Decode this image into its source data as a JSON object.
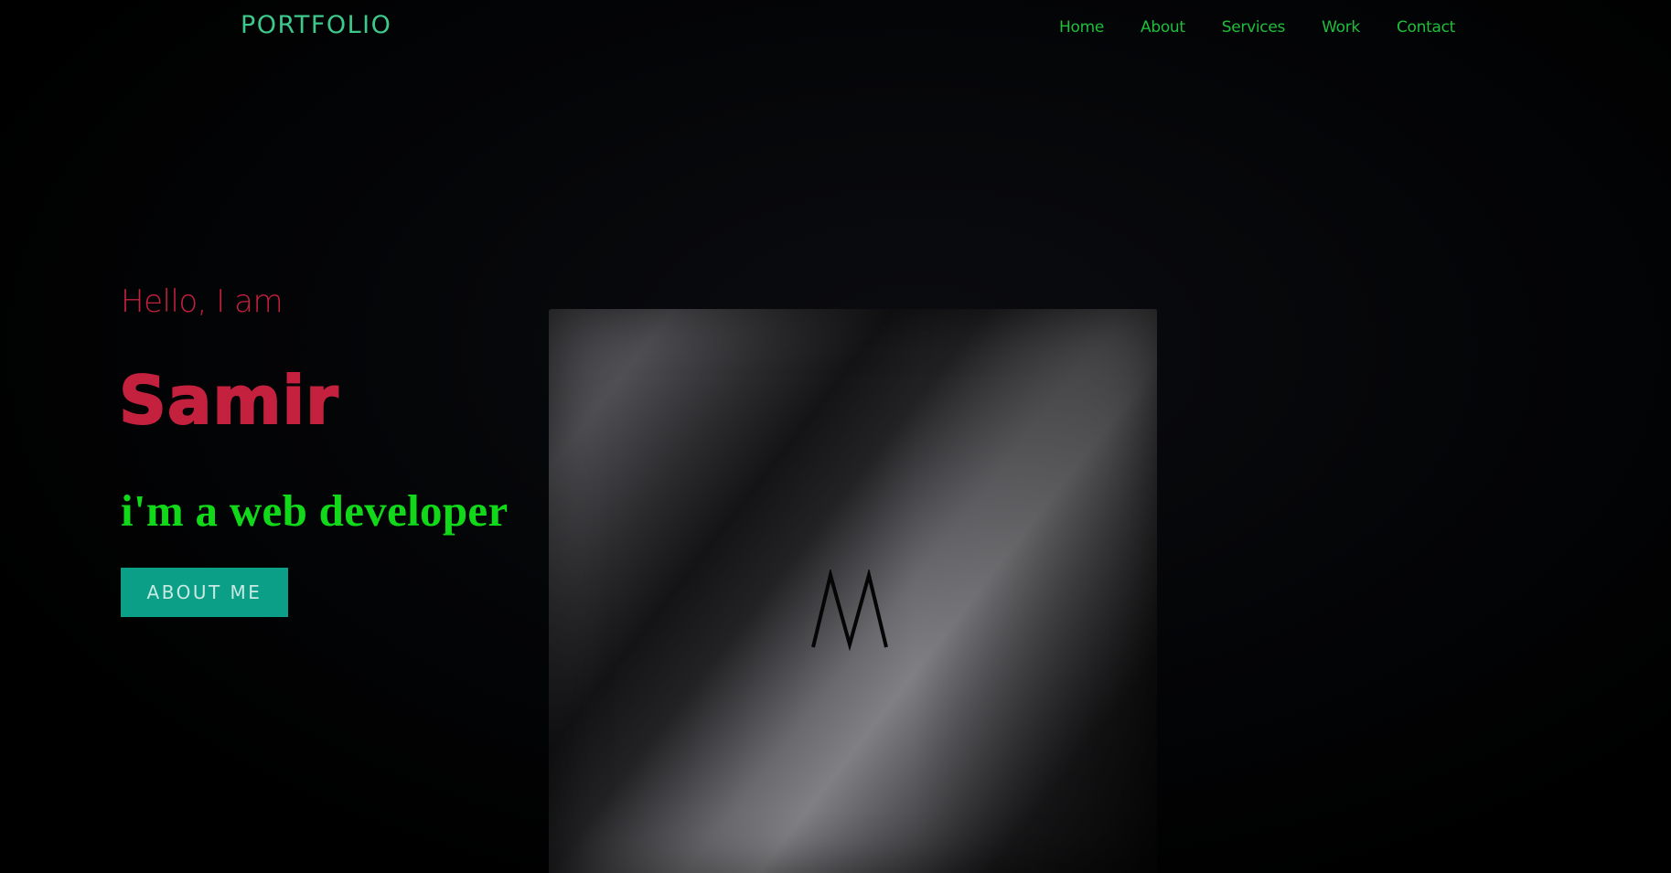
{
  "header": {
    "logo": "PORTFOLIO",
    "nav": [
      {
        "label": "Home"
      },
      {
        "label": "About"
      },
      {
        "label": "Services"
      },
      {
        "label": "Work"
      },
      {
        "label": "Contact"
      }
    ]
  },
  "hero": {
    "greeting": "Hello, I am",
    "name": "Samir",
    "role": "i'm a web developer",
    "button_label": "ABOUT ME",
    "image_letter": "M"
  },
  "colors": {
    "background": "#000000",
    "logo": "#3ec98c",
    "nav": "#1fbf3c",
    "accent_red": "#c4213f",
    "accent_green": "#11d91a",
    "button": "#0a9f86"
  }
}
